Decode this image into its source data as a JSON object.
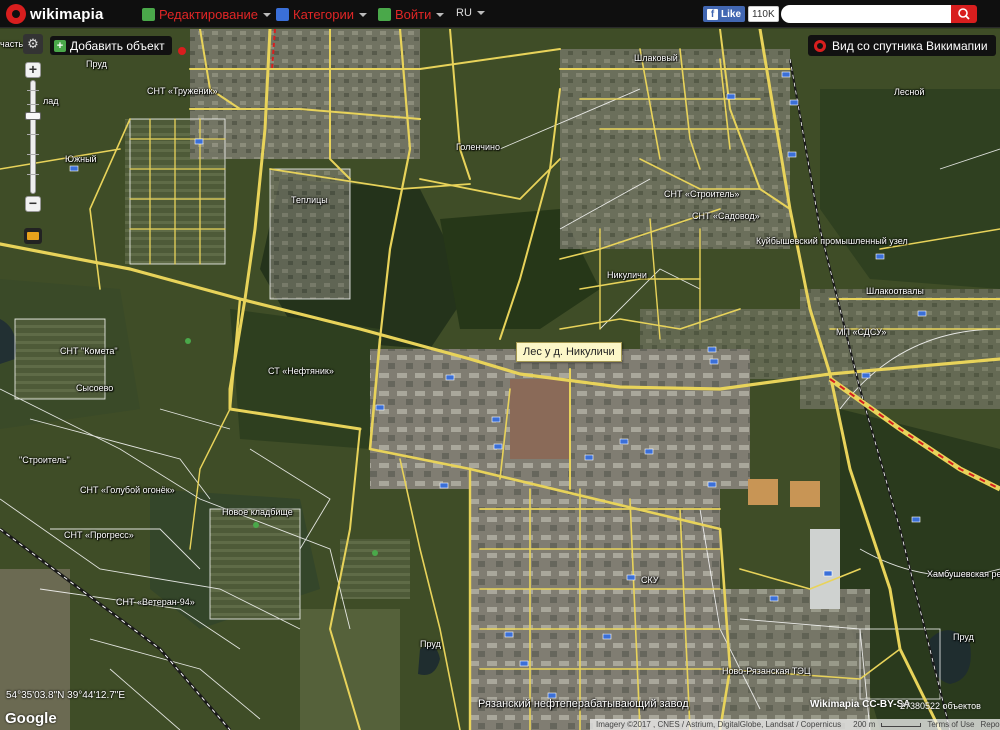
{
  "topbar": {
    "brand": "wikimapia",
    "nav": [
      {
        "label": "Редактирование",
        "icon": "pencil-icon",
        "icon_color": "#4aa84a"
      },
      {
        "label": "Категории",
        "icon": "categories-icon",
        "icon_color": "#3a6fd8"
      },
      {
        "label": "Войти",
        "icon": "login-icon",
        "icon_color": "#4aa84a"
      }
    ],
    "language": "RU",
    "facebook": {
      "label": "Like",
      "count": "110K"
    },
    "search": {
      "placeholder": ""
    }
  },
  "map_controls": {
    "settings_icon": "gear-icon",
    "zoom_in": "+",
    "zoom_out": "−",
    "zoom_level_fraction": 0.7,
    "add_object": "Добавить объект",
    "satellite_view": "Вид со спутника Викимапии"
  },
  "tooltip": "Лес у д. Никуличи",
  "labels": [
    {
      "text": "Пруд"
    },
    {
      "text": "СНТ «Труженик»"
    },
    {
      "text": "Южный"
    },
    {
      "text": "Голенчино"
    },
    {
      "text": "Теплицы"
    },
    {
      "text": "Шлаковый"
    },
    {
      "text": "Лесной"
    },
    {
      "text": "СНТ «Строитель»"
    },
    {
      "text": "СНТ «Садовод»"
    },
    {
      "text": "Куйбышевский промышленный узел"
    },
    {
      "text": "Никуличи"
    },
    {
      "text": "Шлакоотвалы"
    },
    {
      "text": "МП «СДСУ»"
    },
    {
      "text": "СНТ \"Комета\""
    },
    {
      "text": "СТ «Нефтяник»"
    },
    {
      "text": "Сысоево"
    },
    {
      "text": "\"Строитель\""
    },
    {
      "text": "СНТ «Голубой огонёк»"
    },
    {
      "text": "Новое кладбище"
    },
    {
      "text": "СНТ «Прогресс»"
    },
    {
      "text": "СНТ «Ветеран-94»"
    },
    {
      "text": "СКУ"
    },
    {
      "text": "Пруд"
    },
    {
      "text": "Ново-Рязанская ТЭЦ"
    },
    {
      "text": "Хамбушевская ре"
    },
    {
      "text": "Пруд"
    },
    {
      "text": "Рязанский нефтеперабатывающий завод"
    },
    {
      "text": "часть"
    },
    {
      "text": "лад"
    }
  ],
  "status": {
    "coordinates": "54°35'03.8\"N 39°44'12.7\"E",
    "google": "Google",
    "wikimapia_license": "Wikimapia CC-BY-SA",
    "object_count": "27380522 объектов",
    "imagery": "Imagery ©2017 , CNES / Astrium, DigitalGlobe, Landsat / Copernicus",
    "scale": "200 m",
    "terms": "Terms of Use",
    "report": "Report a map error"
  },
  "colors": {
    "road": "#e8d35a",
    "boundary": "#ffffff",
    "brand_red": "#d81e1e",
    "topbar_bg": "#0f0f0f"
  }
}
